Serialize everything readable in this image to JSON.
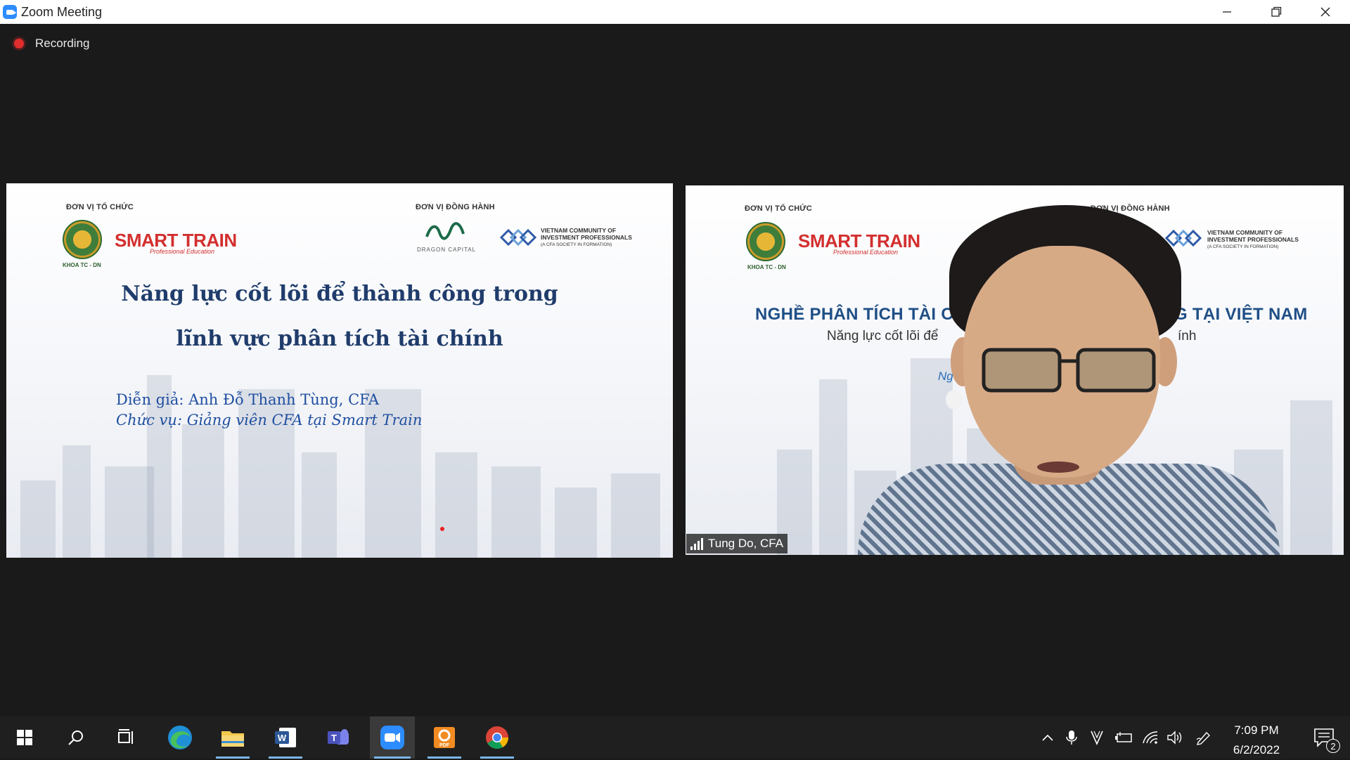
{
  "window": {
    "title": "Zoom Meeting",
    "minimize_icon": "minimize-icon",
    "maximize_icon": "restore-icon",
    "close_icon": "close-icon"
  },
  "recording": {
    "label": "Recording",
    "color": "#e02d2d"
  },
  "shared_slide": {
    "organizer_label": "ĐƠN VỊ TỔ CHỨC",
    "partner_label": "ĐƠN VỊ ĐỒNG HÀNH",
    "seal_caption": "KHOA TC - DN",
    "smart_train": "SMART TRAIN",
    "smart_train_sub": "Professional Education",
    "dragon_caption": "DRAGON CAPITAL",
    "vcip_line1": "VIETNAM COMMUNITY OF",
    "vcip_line2": "INVESTMENT PROFESSIONALS",
    "vcip_sub": "(A CFA SOCIETY IN FORMATION)",
    "title_line1": "Năng lực cốt lõi để thành công trong",
    "title_line2": "lĩnh vực phân tích tài chính",
    "speaker_line": "Diễn giả: Anh Đỗ Thanh Tùng, CFA",
    "position_line": "Chức vụ: Giảng viên CFA tại Smart Train"
  },
  "video_tile": {
    "organizer_label": "ĐƠN VỊ TỔ CHỨC",
    "partner_label": "ĐƠN VỊ ĐỒNG HÀNH",
    "seal_caption": "KHOA TC - DN",
    "smart_train": "SMART TRAIN",
    "smart_train_sub": "Professional Education",
    "vcip_line1": "VIETNAM COMMUNITY OF",
    "vcip_line2": "INVESTMENT PROFESSIONALS",
    "vcip_sub": "(A CFA SOCIETY IN FORMATION)",
    "heading_left": "NGHỀ PHÂN TÍCH TÀI CHÍ",
    "heading_right": "G TẠI VIỆT NAM",
    "sub_left": "Năng lực cốt lõi để",
    "sub_right": "ính",
    "ng_fragment": "Ng",
    "participant_name": "Tung Do, CFA",
    "signal_icon": "signal-bars-icon"
  },
  "taskbar": {
    "apps": [
      {
        "name": "start-icon"
      },
      {
        "name": "search-icon"
      },
      {
        "name": "task-view-icon"
      },
      {
        "name": "edge-icon"
      },
      {
        "name": "file-explorer-icon"
      },
      {
        "name": "word-icon",
        "letter": "W"
      },
      {
        "name": "teams-icon",
        "letter": "T"
      },
      {
        "name": "zoom-icon"
      },
      {
        "name": "foxit-pdf-icon",
        "letter": "PDF"
      },
      {
        "name": "chrome-icon"
      }
    ],
    "time": "7:09 PM",
    "date": "6/2/2022",
    "notification_count": "2"
  }
}
